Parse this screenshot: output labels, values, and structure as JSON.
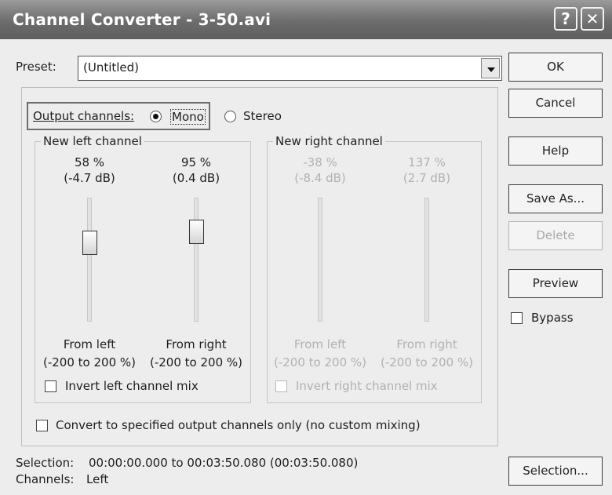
{
  "window": {
    "title": "Channel Converter - 3-50.avi",
    "help_glyph": "?",
    "close_glyph": "✕"
  },
  "preset": {
    "label": "Preset:",
    "value": "(Untitled)"
  },
  "output": {
    "label": "Output channels:",
    "mono": "Mono",
    "stereo": "Stereo",
    "selected": "Mono"
  },
  "left_group": {
    "title": "New left channel",
    "from_left": {
      "percent": "58 %",
      "db": "(-4.7 dB)",
      "label": "From left",
      "range": "(-200 to 200 %)",
      "level": 0.58
    },
    "from_right": {
      "percent": "95 %",
      "db": "(0.4 dB)",
      "label": "From right",
      "range": "(-200 to 200 %)",
      "level": 0.95
    },
    "invert": "Invert left channel mix"
  },
  "right_group": {
    "title": "New right channel",
    "from_left": {
      "percent": "-38 %",
      "db": "(-8.4 dB)",
      "label": "From left",
      "range": "(-200 to 200 %)"
    },
    "from_right": {
      "percent": "137 %",
      "db": "(2.7 dB)",
      "label": "From right",
      "range": "(-200 to 200 %)"
    },
    "invert": "Invert right channel mix"
  },
  "convert_only": "Convert to specified output channels only (no custom mixing)",
  "buttons": {
    "ok": "OK",
    "cancel": "Cancel",
    "help": "Help",
    "save_as": "Save As...",
    "delete": "Delete",
    "preview": "Preview",
    "bypass": "Bypass",
    "selection": "Selection..."
  },
  "status": {
    "selection_label": "Selection:",
    "selection_value": "00:00:00.000 to 00:03:50.080 (00:03:50.080)",
    "channels_label": "Channels:",
    "channels_value": "Left"
  }
}
